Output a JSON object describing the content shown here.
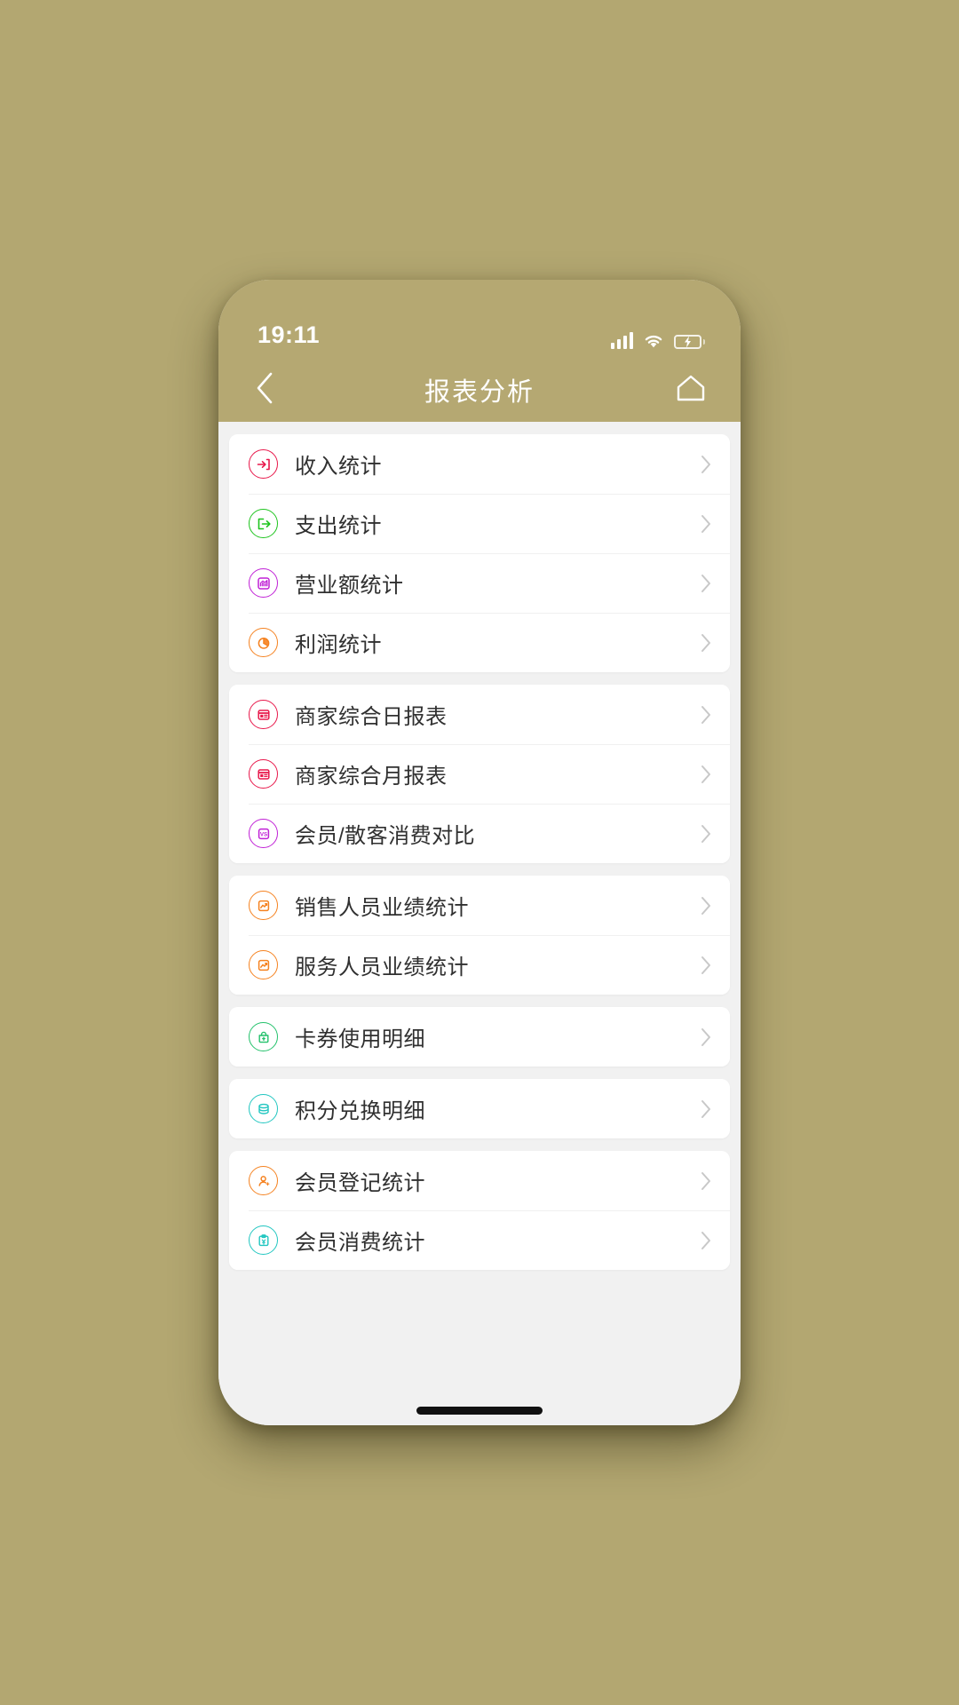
{
  "status_bar": {
    "time": "19:11",
    "signal_icon": "cellular-signal-icon",
    "wifi_icon": "wifi-icon",
    "battery_icon": "battery-charging-icon"
  },
  "nav_bar": {
    "back_icon": "chevron-left-icon",
    "title": "报表分析",
    "home_icon": "home-icon",
    "background_color": "#b5a872"
  },
  "theme": {
    "page_background": "#b3a771",
    "list_background": "#f1f1f1",
    "card_background": "#ffffff",
    "label_color": "#303030",
    "chevron_color": "#c8c8c8"
  },
  "groups": [
    {
      "items": [
        {
          "label": "收入统计",
          "icon": "income-arrow-in-icon",
          "color": "#e8174a",
          "chevron": "chevron-right-icon"
        },
        {
          "label": "支出统计",
          "icon": "expense-arrow-out-icon",
          "color": "#1ec41e",
          "chevron": "chevron-right-icon"
        },
        {
          "label": "营业额统计",
          "icon": "turnover-bar-chart-icon",
          "color": "#c021d6",
          "chevron": "chevron-right-icon"
        },
        {
          "label": "利润统计",
          "icon": "profit-pie-chart-icon",
          "color": "#f58220",
          "chevron": "chevron-right-icon"
        }
      ]
    },
    {
      "items": [
        {
          "label": "商家综合日报表",
          "icon": "daily-report-icon",
          "color": "#e8174a",
          "chevron": "chevron-right-icon"
        },
        {
          "label": "商家综合月报表",
          "icon": "monthly-report-icon",
          "color": "#e8174a",
          "chevron": "chevron-right-icon"
        },
        {
          "label": "会员/散客消费对比",
          "icon": "member-vs-guest-icon",
          "color": "#c021d6",
          "chevron": "chevron-right-icon"
        }
      ]
    },
    {
      "items": [
        {
          "label": "销售人员业绩统计",
          "icon": "sales-performance-icon",
          "color": "#f58220",
          "chevron": "chevron-right-icon"
        },
        {
          "label": "服务人员业绩统计",
          "icon": "service-performance-icon",
          "color": "#f58220",
          "chevron": "chevron-right-icon"
        }
      ]
    },
    {
      "items": [
        {
          "label": "卡券使用明细",
          "icon": "coupon-usage-icon",
          "color": "#23c16b",
          "chevron": "chevron-right-icon"
        }
      ]
    },
    {
      "items": [
        {
          "label": "积分兑换明细",
          "icon": "points-exchange-icon",
          "color": "#21c6c0",
          "chevron": "chevron-right-icon"
        }
      ]
    },
    {
      "items": [
        {
          "label": "会员登记统计",
          "icon": "member-register-icon",
          "color": "#f58220",
          "chevron": "chevron-right-icon"
        },
        {
          "label": "会员消费统计",
          "icon": "member-consumption-icon",
          "color": "#21c6c0",
          "chevron": "chevron-right-icon"
        }
      ]
    }
  ],
  "home_indicator": "home-indicator-bar"
}
